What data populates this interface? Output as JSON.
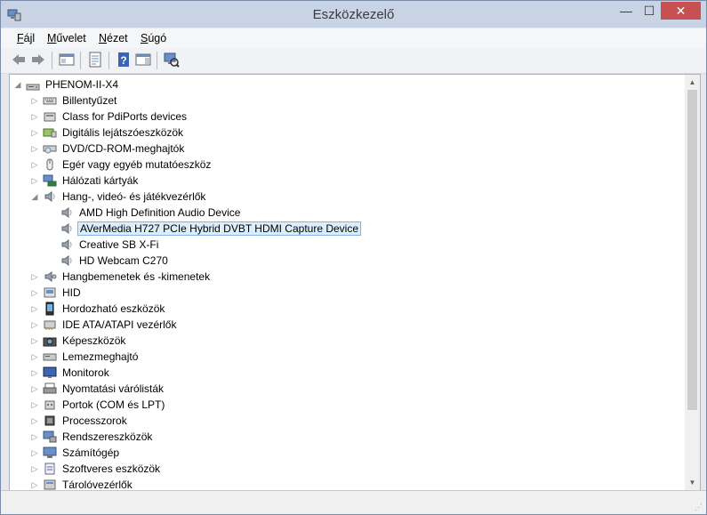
{
  "window": {
    "title": "Eszközkezelő"
  },
  "window_controls": {
    "minimize": "—",
    "maximize": "☐",
    "close": "✕"
  },
  "menu": [
    {
      "key": "F",
      "rest": "ájl"
    },
    {
      "key": "M",
      "rest": "űvelet"
    },
    {
      "key": "N",
      "rest": "ézet"
    },
    {
      "key": "S",
      "rest": "úgó"
    }
  ],
  "tree": {
    "root": "PHENOM-II-X4",
    "items": [
      {
        "label": "Billentyűzet",
        "icon": "keyboard-icon"
      },
      {
        "label": "Class for PdiPorts devices",
        "icon": "device-class-icon"
      },
      {
        "label": "Digitális lejátszóeszközök",
        "icon": "media-player-icon"
      },
      {
        "label": "DVD/CD-ROM-meghajtók",
        "icon": "dvd-drive-icon"
      },
      {
        "label": "Egér vagy egyéb mutatóeszköz",
        "icon": "mouse-icon"
      },
      {
        "label": "Hálózati kártyák",
        "icon": "network-adapter-icon"
      },
      {
        "label": "Hang-, videó- és játékvezérlők",
        "icon": "speaker-icon",
        "expanded": true
      },
      {
        "label": "AMD High Definition Audio Device",
        "icon": "speaker-icon",
        "child": true
      },
      {
        "label": "AVerMedia H727 PCIe Hybrid DVBT HDMI Capture Device",
        "icon": "speaker-icon",
        "child": true,
        "selected": true
      },
      {
        "label": "Creative SB X-Fi",
        "icon": "speaker-icon",
        "child": true
      },
      {
        "label": "HD Webcam C270",
        "icon": "speaker-icon",
        "child": true
      },
      {
        "label": "Hangbemenetek és -kimenetek",
        "icon": "audio-io-icon"
      },
      {
        "label": "HID",
        "icon": "hid-icon"
      },
      {
        "label": "Hordozható eszközök",
        "icon": "portable-device-icon"
      },
      {
        "label": "IDE ATA/ATAPI vezérlők",
        "icon": "ide-controller-icon"
      },
      {
        "label": "Képeszközök",
        "icon": "camera-icon"
      },
      {
        "label": "Lemezmeghajtó",
        "icon": "disk-drive-icon"
      },
      {
        "label": "Monitorok",
        "icon": "monitor-icon"
      },
      {
        "label": "Nyomtatási várólisták",
        "icon": "printer-icon"
      },
      {
        "label": "Portok (COM és LPT)",
        "icon": "port-icon"
      },
      {
        "label": "Processzorok",
        "icon": "processor-icon"
      },
      {
        "label": "Rendszereszközök",
        "icon": "system-device-icon"
      },
      {
        "label": "Számítógép",
        "icon": "computer-icon"
      },
      {
        "label": "Szoftveres eszközök",
        "icon": "software-device-icon"
      },
      {
        "label": "Tárolóvezérlők",
        "icon": "storage-controller-icon"
      }
    ]
  },
  "colors": {
    "selection_bg": "#dceefc",
    "selection_border": "#7eb4ea",
    "close_button": "#c75050"
  }
}
